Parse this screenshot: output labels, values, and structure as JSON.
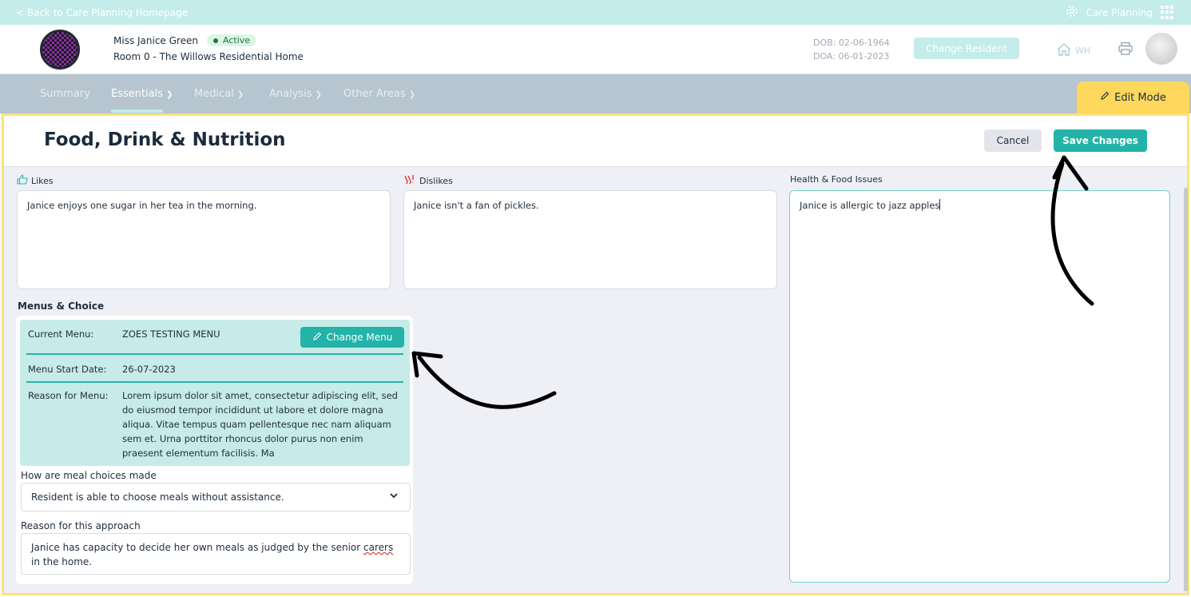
{
  "topbar": {
    "back_link": "< Back to Care Planning Homepage",
    "module_name": "Care Planning",
    "settings_icon": "gear-icon",
    "apps_icon": "grid-icon"
  },
  "resident": {
    "name": "Miss Janice Green",
    "status": "Active",
    "room": "Room 0 - The Willows Residential Home",
    "dob": "DOB: 02-06-1964",
    "doa": "DOA: 06-01-2023",
    "change_button": "Change Resident",
    "home_code": "WH"
  },
  "nav": {
    "items": [
      {
        "label": "Summary",
        "has_dropdown": false
      },
      {
        "label": "Essentials",
        "has_dropdown": true,
        "active": true
      },
      {
        "label": "Medical",
        "has_dropdown": true
      },
      {
        "label": "Analysis",
        "has_dropdown": true
      },
      {
        "label": "Other Areas",
        "has_dropdown": true
      }
    ],
    "edit_mode": "Edit Mode"
  },
  "page": {
    "title": "Food, Drink & Nutrition",
    "cancel": "Cancel",
    "save": "Save Changes"
  },
  "likes": {
    "label": "Likes",
    "text": "Janice enjoys one sugar in her tea in the morning."
  },
  "dislikes": {
    "label": "Dislikes",
    "text": "Janice isn't a fan of pickles."
  },
  "health": {
    "label": "Health & Food Issues",
    "text": "Janice is allergic to jazz apples"
  },
  "menus": {
    "section_title": "Menus & Choice",
    "current_menu_label": "Current Menu:",
    "current_menu_value": "ZOES TESTING MENU",
    "change_menu": "Change Menu",
    "start_date_label": "Menu Start Date:",
    "start_date_value": "26-07-2023",
    "reason_label": "Reason for Menu:",
    "reason_value": "Lorem ipsum dolor sit amet, consectetur adipiscing elit, sed do eiusmod tempor incididunt ut labore et dolore magna aliqua. Vitae tempus quam pellentesque nec nam aliquam sem et. Urna porttitor rhoncus dolor purus non enim praesent elementum facilisis. Ma",
    "meal_choice_label": "How are meal choices made",
    "meal_choice_value": "Resident is able to choose meals without assistance.",
    "approach_label": "Reason for this approach",
    "approach_text_before": "Janice has capacity to decide her own meals as judged by the senior ",
    "approach_text_marked": "carers",
    "approach_text_after": " in the home."
  },
  "colors": {
    "accent": "#23b3a8",
    "light_accent": "#c4ecea",
    "edit_mode": "#fdd85d",
    "nav_bg": "#b6c5cf"
  }
}
